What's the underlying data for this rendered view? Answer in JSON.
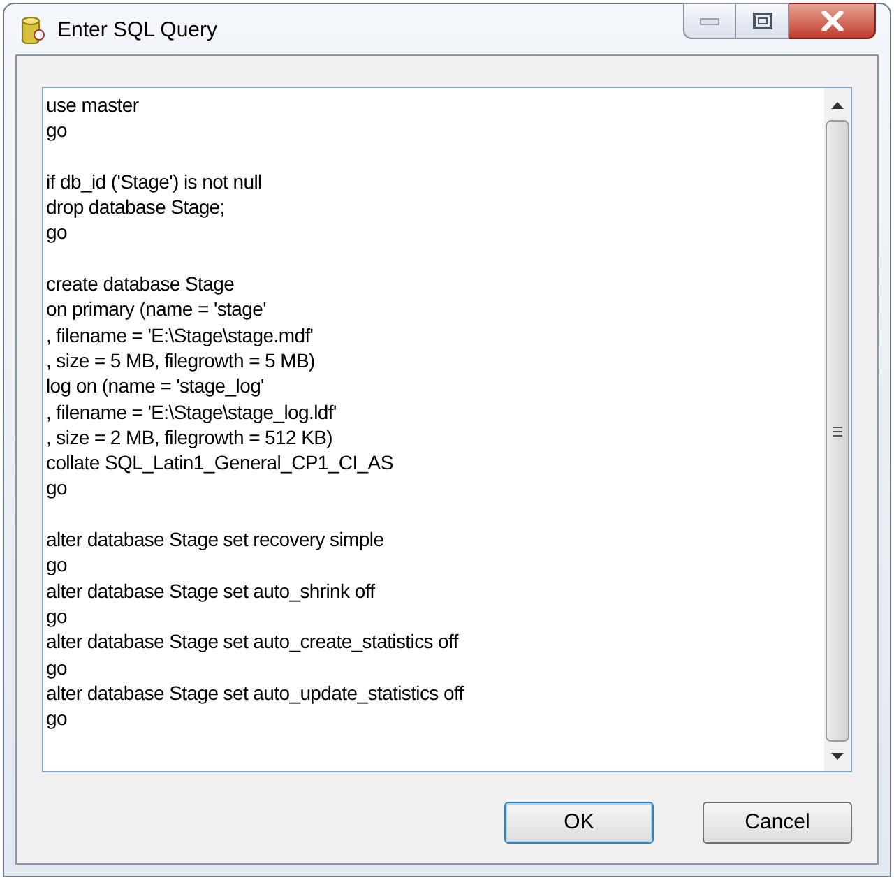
{
  "window": {
    "title": "Enter SQL Query"
  },
  "query": {
    "value": "use master\ngo\n\nif db_id ('Stage') is not null\ndrop database Stage;\ngo\n\ncreate database Stage\non primary (name = 'stage'\n, filename = 'E:\\Stage\\stage.mdf'\n, size = 5 MB, filegrowth = 5 MB)\nlog on (name = 'stage_log'\n, filename = 'E:\\Stage\\stage_log.ldf'\n, size = 2 MB, filegrowth = 512 KB)\ncollate SQL_Latin1_General_CP1_CI_AS\ngo\n\nalter database Stage set recovery simple\ngo\nalter database Stage set auto_shrink off\ngo\nalter database Stage set auto_create_statistics off\ngo\nalter database Stage set auto_update_statistics off\ngo"
  },
  "buttons": [
    {
      "label": "OK",
      "default": true
    },
    {
      "label": "Cancel",
      "default": false
    }
  ]
}
